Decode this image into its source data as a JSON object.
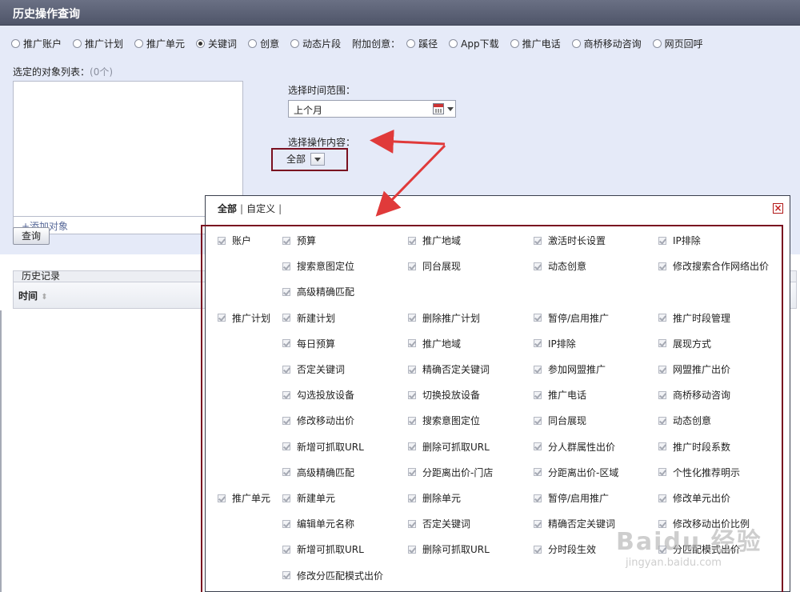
{
  "window": {
    "title": "历史操作查询"
  },
  "scope_options": [
    {
      "label": "推广账户",
      "checked": false
    },
    {
      "label": "推广计划",
      "checked": false
    },
    {
      "label": "推广单元",
      "checked": false
    },
    {
      "label": "关键词",
      "checked": true
    },
    {
      "label": "创意",
      "checked": false
    },
    {
      "label": "动态片段",
      "checked": false
    }
  ],
  "addon": {
    "label": "附加创意：",
    "options": [
      {
        "label": "蹊径",
        "checked": false
      },
      {
        "label": "App下载",
        "checked": false
      },
      {
        "label": "推广电话",
        "checked": false
      },
      {
        "label": "商桥移动咨询",
        "checked": false
      },
      {
        "label": "网页回呼",
        "checked": false
      }
    ]
  },
  "objects": {
    "label": "选定的对象列表：",
    "count": "(0个)",
    "add_link": "+添加对象"
  },
  "time_range": {
    "label": "选择时间范围：",
    "value": "上个月"
  },
  "operation": {
    "label": "选择操作内容：",
    "value": "全部"
  },
  "query_button": "查询",
  "history": {
    "title": "历史记录",
    "column_time": "时间"
  },
  "popup": {
    "tab_all": "全部",
    "tab_custom": "自定义",
    "sep": "|",
    "close": "×",
    "groups": [
      {
        "name": "账户",
        "rows": [
          [
            "预算",
            "推广地域",
            "激活时长设置",
            "IP排除"
          ],
          [
            "搜索意图定位",
            "同台展现",
            "动态创意",
            "修改搜索合作网络出价"
          ],
          [
            "高级精确匹配"
          ]
        ]
      },
      {
        "name": "推广计划",
        "rows": [
          [
            "新建计划",
            "删除推广计划",
            "暂停/启用推广",
            "推广时段管理"
          ],
          [
            "每日预算",
            "推广地域",
            "IP排除",
            "展现方式"
          ],
          [
            "否定关键词",
            "精确否定关键词",
            "参加网盟推广",
            "网盟推广出价"
          ],
          [
            "勾选投放设备",
            "切换投放设备",
            "推广电话",
            "商桥移动咨询"
          ],
          [
            "修改移动出价",
            "搜索意图定位",
            "同台展现",
            "动态创意"
          ],
          [
            "新增可抓取URL",
            "删除可抓取URL",
            "分人群属性出价",
            "推广时段系数"
          ],
          [
            "高级精确匹配",
            "分距离出价-门店",
            "分距离出价-区域",
            "个性化推荐明示"
          ]
        ]
      },
      {
        "name": "推广单元",
        "rows": [
          [
            "新建单元",
            "删除单元",
            "暂停/启用推广",
            "修改单元出价"
          ],
          [
            "编辑单元名称",
            "否定关键词",
            "精确否定关键词",
            "修改移动出价比例"
          ],
          [
            "新增可抓取URL",
            "删除可抓取URL",
            "分时段生效",
            "分匹配模式出价"
          ],
          [
            "修改分匹配模式出价"
          ]
        ]
      }
    ]
  },
  "watermark": {
    "big": "Baidu 经验",
    "small": "jingyan.baidu.com"
  },
  "colors": {
    "title_bar": "#5a6075",
    "panel_bg": "#e5eaf8",
    "highlight": "#7a1020",
    "arrow": "#e03a3a"
  }
}
